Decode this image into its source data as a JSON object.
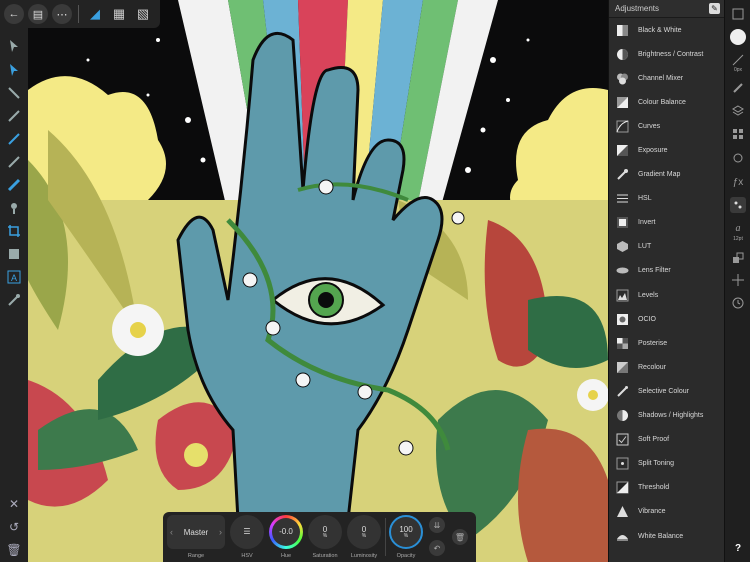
{
  "panel": {
    "title": "Adjustments",
    "items": [
      {
        "label": "Black & White",
        "icon": "black-white-icon"
      },
      {
        "label": "Brightness / Contrast",
        "icon": "brightness-contrast-icon"
      },
      {
        "label": "Channel Mixer",
        "icon": "channel-mixer-icon"
      },
      {
        "label": "Colour Balance",
        "icon": "colour-balance-icon"
      },
      {
        "label": "Curves",
        "icon": "curves-icon"
      },
      {
        "label": "Exposure",
        "icon": "exposure-icon"
      },
      {
        "label": "Gradient Map",
        "icon": "gradient-map-icon"
      },
      {
        "label": "HSL",
        "icon": "hsl-icon"
      },
      {
        "label": "Invert",
        "icon": "invert-icon"
      },
      {
        "label": "LUT",
        "icon": "lut-icon"
      },
      {
        "label": "Lens Filter",
        "icon": "lens-filter-icon"
      },
      {
        "label": "Levels",
        "icon": "levels-icon"
      },
      {
        "label": "OCIO",
        "icon": "ocio-icon"
      },
      {
        "label": "Posterise",
        "icon": "posterise-icon"
      },
      {
        "label": "Recolour",
        "icon": "recolour-icon"
      },
      {
        "label": "Selective Colour",
        "icon": "selective-colour-icon"
      },
      {
        "label": "Shadows / Highlights",
        "icon": "shadows-highlights-icon"
      },
      {
        "label": "Soft Proof",
        "icon": "soft-proof-icon"
      },
      {
        "label": "Split Toning",
        "icon": "split-toning-icon"
      },
      {
        "label": "Threshold",
        "icon": "threshold-icon"
      },
      {
        "label": "Vibrance",
        "icon": "vibrance-icon"
      },
      {
        "label": "White Balance",
        "icon": "white-balance-icon"
      }
    ]
  },
  "studio": {
    "brush_size": "0px",
    "font_size": "12pt",
    "help": "?"
  },
  "context": {
    "range_label": "Range",
    "range_value": "Master",
    "hsv_label": "HSV",
    "hue_label": "Hue",
    "hue_value": "-0.0",
    "saturation_label": "Saturation",
    "saturation_value": "0",
    "saturation_unit": "%",
    "luminosity_label": "Luminosity",
    "luminosity_value": "0",
    "luminosity_unit": "%",
    "opacity_label": "Opacity",
    "opacity_value": "100",
    "opacity_unit": "%"
  },
  "colors": {
    "accent": "#2a8fd6",
    "panel_bg": "#2b2b2b",
    "toolbar_bg": "#232323"
  }
}
